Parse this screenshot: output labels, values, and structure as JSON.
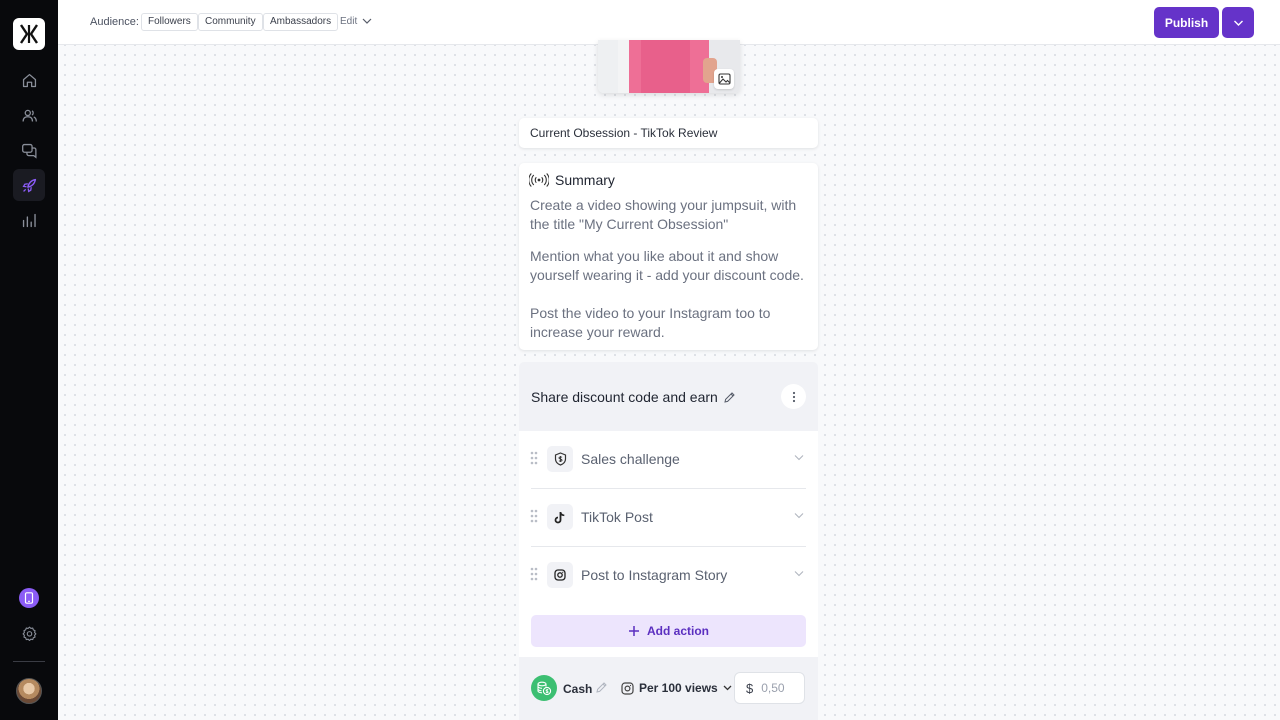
{
  "sidebar": {
    "logo": "brand-logo",
    "nav": [
      {
        "name": "home",
        "icon": "home-icon",
        "active": false
      },
      {
        "name": "users",
        "icon": "users-icon",
        "active": false
      },
      {
        "name": "messages",
        "icon": "chat-icon",
        "active": false
      },
      {
        "name": "campaigns",
        "icon": "rocket-icon",
        "active": true
      },
      {
        "name": "analytics",
        "icon": "bar-chart-icon",
        "active": false
      }
    ],
    "bottom": [
      {
        "name": "mobile-preview",
        "icon": "phone-icon"
      },
      {
        "name": "settings",
        "icon": "gear-icon"
      },
      {
        "name": "profile",
        "icon": "avatar"
      }
    ]
  },
  "header": {
    "audience_label": "Audience:",
    "audience_chips": [
      "Followers",
      "Community",
      "Ambassadors"
    ],
    "edit_label": "Edit",
    "publish_label": "Publish"
  },
  "main": {
    "campaign_title": "Current Obsession - TikTok Review",
    "summary": {
      "heading": "Summary",
      "paragraphs": [
        "Create a video showing your jumpsuit, with the title \"My Current Obsession\"",
        "Mention what you like about it and show yourself wearing it - add your discount code.",
        "Post the video to your Instagram too to increase your reward."
      ]
    },
    "reward": {
      "title": "Share discount code and earn",
      "actions": [
        {
          "label": "Sales challenge",
          "icon": "shield-dollar-icon"
        },
        {
          "label": "TikTok Post",
          "icon": "tiktok-icon"
        },
        {
          "label": "Post to Instagram Story",
          "icon": "instagram-icon"
        }
      ],
      "add_action_label": "Add action",
      "payout_type": "Cash",
      "payout_metric": "Per 100 views",
      "currency_symbol": "$",
      "amount_placeholder": "0,50"
    }
  },
  "colors": {
    "accent": "#6533c9",
    "accent_light": "#ede5fd",
    "cash_green": "#3cbf72",
    "sidebar_bg": "#08090c"
  }
}
